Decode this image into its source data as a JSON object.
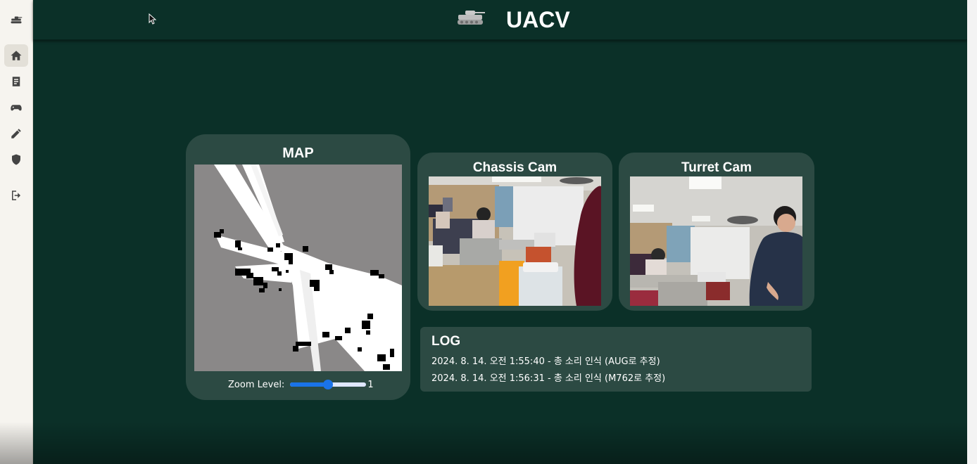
{
  "app": {
    "title": "UACV"
  },
  "sidebar": {
    "items": [
      {
        "icon": "tank-icon"
      },
      {
        "icon": "home-icon",
        "active": true
      },
      {
        "icon": "document-icon"
      },
      {
        "icon": "gamepad-icon"
      },
      {
        "icon": "pencil-icon"
      },
      {
        "icon": "shield-icon"
      },
      {
        "icon": "logout-icon"
      }
    ]
  },
  "map": {
    "title": "MAP",
    "zoom_label": "Zoom Level:",
    "zoom_value": "1",
    "zoom_fraction": 0.5
  },
  "cameras": {
    "chassis_title": "Chassis Cam",
    "turret_title": "Turret Cam"
  },
  "log": {
    "title": "LOG",
    "entries": [
      "2024. 8. 14. 오전 1:55:40 - 총 소리 인식 (AUG로 추정)",
      "2024. 8. 14. 오전 1:56:31 - 총 소리 인식 (M762로 추정)"
    ]
  },
  "colors": {
    "background": "#0b3028",
    "panel": "#2c4a43",
    "sidebar": "#f6f4ef",
    "slider_accent": "#1a73e8"
  }
}
